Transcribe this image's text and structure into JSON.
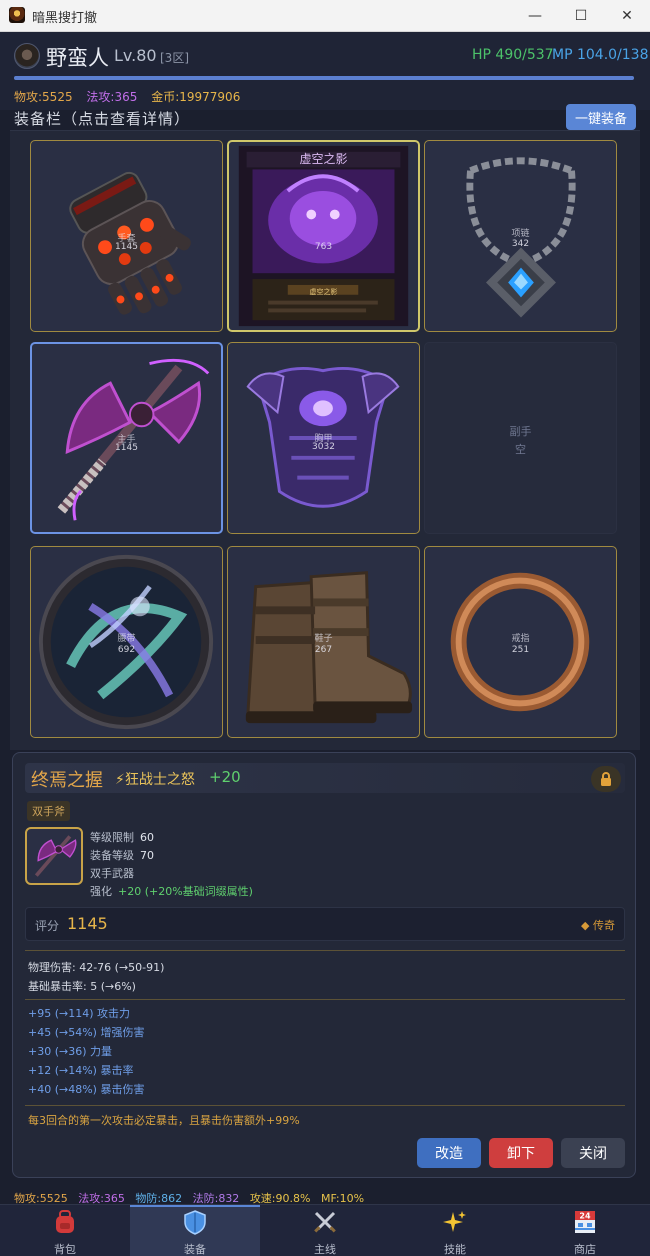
{
  "window": {
    "title": "暗黑搜打撤",
    "controls": {
      "minimize": "—",
      "maximize": "☐",
      "close": "✕"
    }
  },
  "header": {
    "name": "野蛮人",
    "level": "Lv.80",
    "server": "[3区]",
    "hp": "HP 490/537",
    "mp": "MP 104.0/138",
    "xp_progress": 1.0,
    "stats": {
      "phys_atk": "物攻:5525",
      "mag_atk": "法攻:365",
      "gold": "金币:19977906"
    }
  },
  "equipment": {
    "title": "装备栏（点击查看详情）",
    "one_key_button": "一键装备",
    "slots": [
      {
        "id": "gloves",
        "label": "手套",
        "score": "1145",
        "icon": "red-gauntlet-icon"
      },
      {
        "id": "helmet",
        "label": "",
        "score": "763",
        "icon": "void-shadow-card-icon",
        "card_title": "虚空之影",
        "card_caption": "虚空之影"
      },
      {
        "id": "amulet",
        "label": "项链",
        "score": "342",
        "icon": "blue-gem-necklace-icon"
      },
      {
        "id": "weapon",
        "label": "主手",
        "score": "1145",
        "icon": "purple-double-axe-icon"
      },
      {
        "id": "armor",
        "label": "胸甲",
        "score": "3032",
        "icon": "purple-chest-armor-icon"
      },
      {
        "id": "offhand",
        "label": "副手",
        "empty_text": "空",
        "icon": "empty-slot-icon"
      },
      {
        "id": "belt",
        "label": "腰带",
        "score": "692",
        "icon": "swirl-orb-icon"
      },
      {
        "id": "boots",
        "label": "鞋子",
        "score": "267",
        "icon": "leather-boots-icon"
      },
      {
        "id": "ring",
        "label": "戒指",
        "score": "251",
        "icon": "copper-ring-icon"
      }
    ]
  },
  "detail": {
    "name": "终焉之握",
    "set_icon": "⚡",
    "set_name": "狂战士之怒",
    "enhance": "+20",
    "type_badge": "双手斧",
    "info": {
      "level_req_label": "等级限制",
      "level_req": "60",
      "item_level_label": "装备等级",
      "item_level": "70",
      "weapon_type": "双手武器",
      "enhance_label": "强化",
      "enhance_value": "+20 (+20%基础词缀属性)"
    },
    "score_label": "评分",
    "score": "1145",
    "rarity": "◆ 传奇",
    "base_stats": [
      "物理伤害: 42-76 (→50-91)",
      "基础暴击率: 5 (→6%)"
    ],
    "affixes": [
      "+95 (→114) 攻击力",
      "+45 (→54%) 增强伤害",
      "+30 (→36) 力量",
      "+12 (→14%) 暴击率",
      "+40 (→48%) 暴击伤害"
    ],
    "special": "每3回合的第一次攻击必定暴击，且暴击伤害额外+99%",
    "buttons": {
      "reforge": "改造",
      "unequip": "卸下",
      "close": "关闭"
    }
  },
  "bottom_stats": {
    "phys_atk": "物攻:5525",
    "mag_atk": "法攻:365",
    "phys_def": "物防:862",
    "mag_def": "法防:832",
    "atk_speed": "攻速:90.8%",
    "mf": "MF:10%"
  },
  "nav": [
    {
      "label": "背包",
      "icon": "backpack-icon"
    },
    {
      "label": "装备",
      "icon": "shield-icon",
      "active": true
    },
    {
      "label": "主线",
      "icon": "crossed-swords-icon"
    },
    {
      "label": "技能",
      "icon": "sparkles-icon"
    },
    {
      "label": "商店",
      "icon": "shop-24-icon"
    }
  ],
  "colors": {
    "accent": "#5a86d6",
    "gold": "#e6b54a",
    "hp": "#4cc26a",
    "mp": "#4aa3e6",
    "legendary": "#d79a38"
  }
}
